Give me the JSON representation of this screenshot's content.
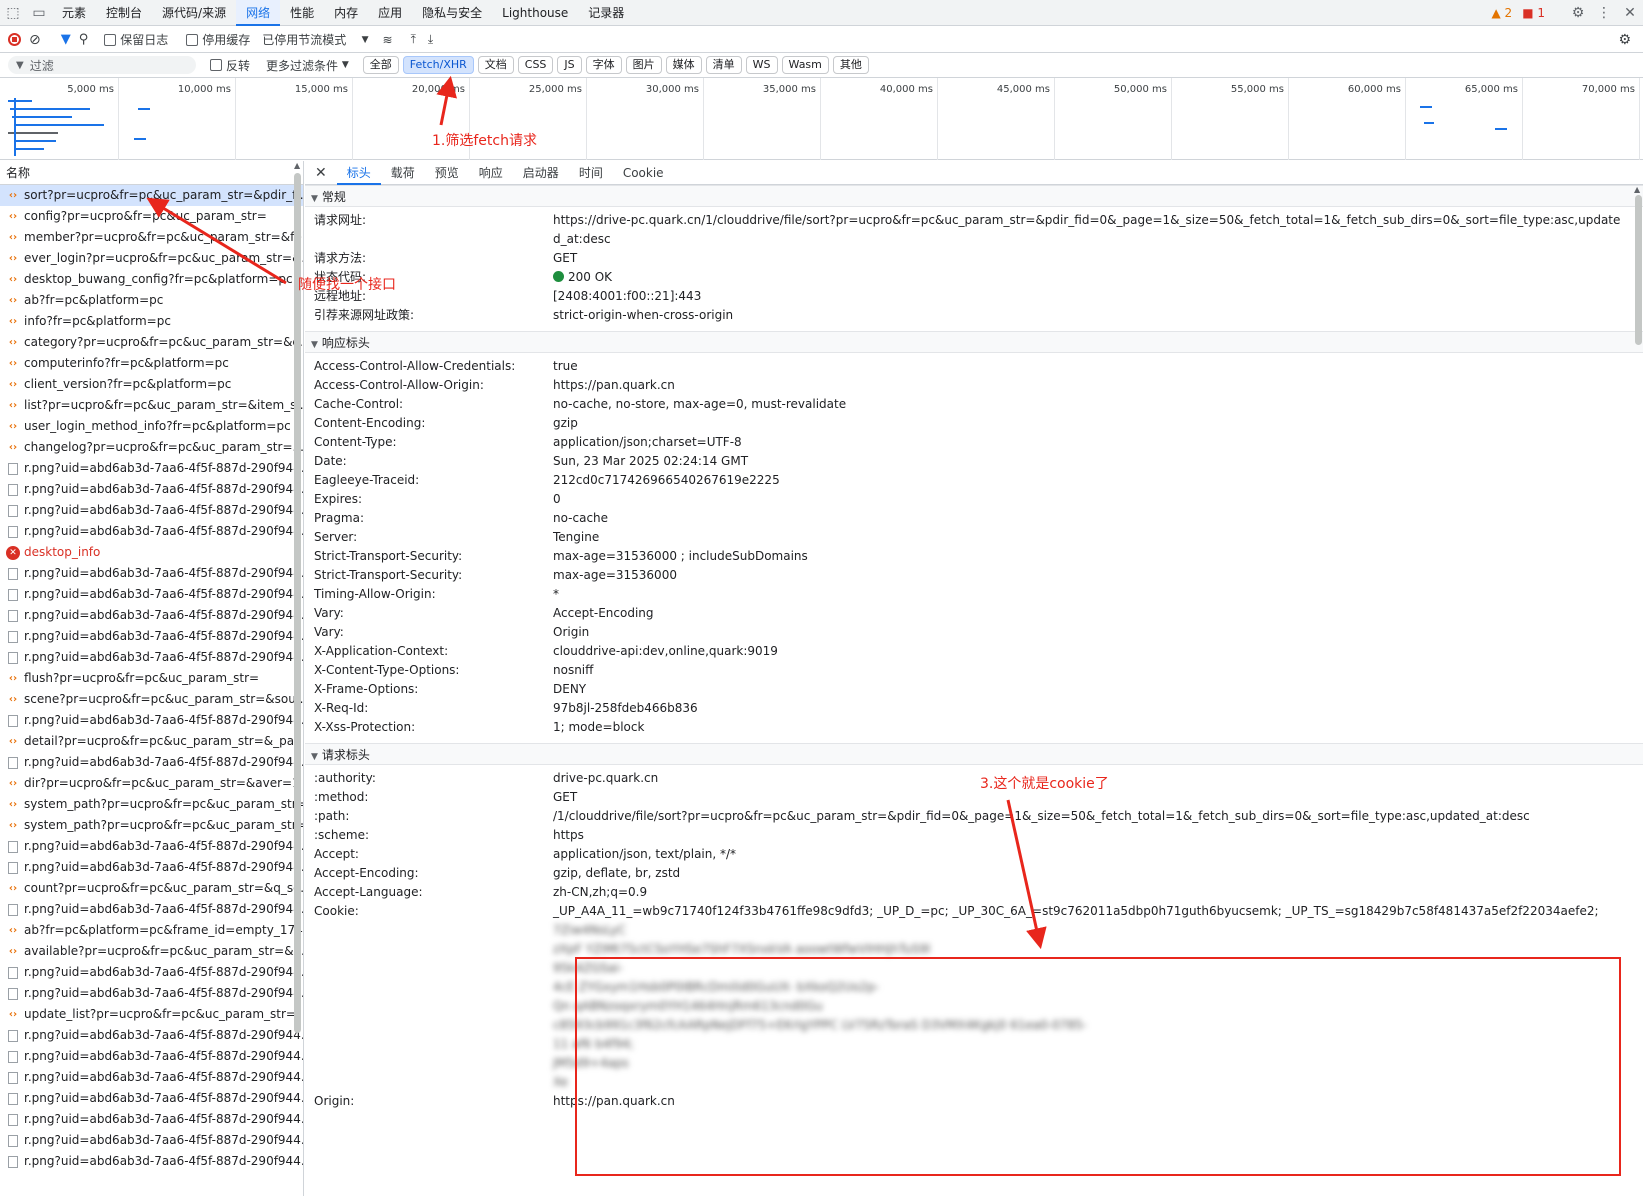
{
  "top_tabs": [
    "元素",
    "控制台",
    "源代码/来源",
    "网络",
    "性能",
    "内存",
    "应用",
    "隐私与安全",
    "Lighthouse",
    "记录器"
  ],
  "top_status": {
    "warnings": "2",
    "issues": "1"
  },
  "toolbar": {
    "preserve_log": "保留日志",
    "disable_cache": "停用缓存",
    "throttle": "已停用节流模式"
  },
  "filterbar": {
    "filter_placeholder": "过滤",
    "invert": "反转",
    "more_filters": "更多过滤条件",
    "chips": [
      "全部",
      "Fetch/XHR",
      "文档",
      "CSS",
      "JS",
      "字体",
      "图片",
      "媒体",
      "清单",
      "WS",
      "Wasm",
      "其他"
    ]
  },
  "timeline_ticks": [
    "5,000 ms",
    "10,000 ms",
    "15,000 ms",
    "20,000 ms",
    "25,000 ms",
    "30,000 ms",
    "35,000 ms",
    "40,000 ms",
    "45,000 ms",
    "50,000 ms",
    "55,000 ms",
    "60,000 ms",
    "65,000 ms",
    "70,000 ms"
  ],
  "list_header": "名称",
  "requests": [
    {
      "name": "sort?pr=ucpro&fr=pc&uc_param_str=&pdir_fi...",
      "type": "fetch"
    },
    {
      "name": "config?pr=ucpro&fr=pc&uc_param_str=",
      "type": "fetch"
    },
    {
      "name": "member?pr=ucpro&fr=pc&uc_param_str=&fe...",
      "type": "fetch"
    },
    {
      "name": "ever_login?pr=ucpro&fr=pc&uc_param_str=&...",
      "type": "fetch"
    },
    {
      "name": "desktop_buwang_config?fr=pc&platform=pc",
      "type": "fetch"
    },
    {
      "name": "ab?fr=pc&platform=pc",
      "type": "fetch"
    },
    {
      "name": "info?fr=pc&platform=pc",
      "type": "fetch"
    },
    {
      "name": "category?pr=ucpro&fr=pc&uc_param_str=&c...",
      "type": "fetch"
    },
    {
      "name": "computerinfo?fr=pc&platform=pc",
      "type": "fetch"
    },
    {
      "name": "client_version?fr=pc&platform=pc",
      "type": "fetch"
    },
    {
      "name": "list?pr=ucpro&fr=pc&uc_param_str=&item_si...",
      "type": "fetch"
    },
    {
      "name": "user_login_method_info?fr=pc&platform=pc",
      "type": "fetch"
    },
    {
      "name": "changelog?pr=ucpro&fr=pc&uc_param_str=...",
      "type": "fetch"
    },
    {
      "name": "r.png?uid=abd6ab3d-7aa6-4f5f-887d-290f944...",
      "type": "img"
    },
    {
      "name": "r.png?uid=abd6ab3d-7aa6-4f5f-887d-290f944...",
      "type": "img"
    },
    {
      "name": "r.png?uid=abd6ab3d-7aa6-4f5f-887d-290f944...",
      "type": "img"
    },
    {
      "name": "r.png?uid=abd6ab3d-7aa6-4f5f-887d-290f944...",
      "type": "img"
    },
    {
      "name": "desktop_info",
      "type": "err"
    },
    {
      "name": "r.png?uid=abd6ab3d-7aa6-4f5f-887d-290f944...",
      "type": "img"
    },
    {
      "name": "r.png?uid=abd6ab3d-7aa6-4f5f-887d-290f944...",
      "type": "img"
    },
    {
      "name": "r.png?uid=abd6ab3d-7aa6-4f5f-887d-290f944...",
      "type": "img"
    },
    {
      "name": "r.png?uid=abd6ab3d-7aa6-4f5f-887d-290f944...",
      "type": "img"
    },
    {
      "name": "r.png?uid=abd6ab3d-7aa6-4f5f-887d-290f944...",
      "type": "img"
    },
    {
      "name": "flush?pr=ucpro&fr=pc&uc_param_str=",
      "type": "fetch"
    },
    {
      "name": "scene?pr=ucpro&fr=pc&uc_param_str=&sour...",
      "type": "fetch"
    },
    {
      "name": "r.png?uid=abd6ab3d-7aa6-4f5f-887d-290f944...",
      "type": "img"
    },
    {
      "name": "detail?pr=ucpro&fr=pc&uc_param_str=&_pag...",
      "type": "fetch"
    },
    {
      "name": "r.png?uid=abd6ab3d-7aa6-4f5f-887d-290f944...",
      "type": "img"
    },
    {
      "name": "dir?pr=ucpro&fr=pc&uc_param_str=&aver=1",
      "type": "fetch"
    },
    {
      "name": "system_path?pr=ucpro&fr=pc&uc_param_str=",
      "type": "fetch"
    },
    {
      "name": "system_path?pr=ucpro&fr=pc&uc_param_str=",
      "type": "fetch"
    },
    {
      "name": "r.png?uid=abd6ab3d-7aa6-4f5f-887d-290f944...",
      "type": "img"
    },
    {
      "name": "r.png?uid=abd6ab3d-7aa6-4f5f-887d-290f944...",
      "type": "img"
    },
    {
      "name": "count?pr=ucpro&fr=pc&uc_param_str=&q_so...",
      "type": "fetch"
    },
    {
      "name": "r.png?uid=abd6ab3d-7aa6-4f5f-887d-290f944...",
      "type": "img"
    },
    {
      "name": "ab?fr=pc&platform=pc&frame_id=empty_174...",
      "type": "fetch"
    },
    {
      "name": "available?pr=ucpro&fr=pc&uc_param_str=&e...",
      "type": "fetch"
    },
    {
      "name": "r.png?uid=abd6ab3d-7aa6-4f5f-887d-290f944...",
      "type": "img"
    },
    {
      "name": "r.png?uid=abd6ab3d-7aa6-4f5f-887d-290f944...",
      "type": "img"
    },
    {
      "name": "update_list?pr=ucpro&fr=pc&uc_param_str=",
      "type": "fetch"
    },
    {
      "name": "r.png?uid=abd6ab3d-7aa6-4f5f-887d-290f944...",
      "type": "img"
    },
    {
      "name": "r.png?uid=abd6ab3d-7aa6-4f5f-887d-290f944...",
      "type": "img"
    },
    {
      "name": "r.png?uid=abd6ab3d-7aa6-4f5f-887d-290f944...",
      "type": "img"
    },
    {
      "name": "r.png?uid=abd6ab3d-7aa6-4f5f-887d-290f944...",
      "type": "img"
    },
    {
      "name": "r.png?uid=abd6ab3d-7aa6-4f5f-887d-290f944...",
      "type": "img"
    },
    {
      "name": "r.png?uid=abd6ab3d-7aa6-4f5f-887d-290f944...",
      "type": "img"
    },
    {
      "name": "r.png?uid=abd6ab3d-7aa6-4f5f-887d-290f944...",
      "type": "img"
    }
  ],
  "detail_tabs": [
    "标头",
    "载荷",
    "预览",
    "响应",
    "启动器",
    "时间",
    "Cookie"
  ],
  "general": {
    "title": "常规",
    "rows": [
      {
        "k": "请求网址:",
        "v": "https://drive-pc.quark.cn/1/clouddrive/file/sort?pr=ucpro&fr=pc&uc_param_str=&pdir_fid=0&_page=1&_size=50&_fetch_total=1&_fetch_sub_dirs=0&_sort=file_type:asc,updated_at:desc"
      },
      {
        "k": "请求方法:",
        "v": "GET"
      },
      {
        "k": "状态代码:",
        "v": "200 OK"
      },
      {
        "k": "远程地址:",
        "v": "[2408:4001:f00::21]:443"
      },
      {
        "k": "引荐来源网址政策:",
        "v": "strict-origin-when-cross-origin"
      }
    ]
  },
  "response_headers": {
    "title": "响应标头",
    "rows": [
      {
        "k": "Access-Control-Allow-Credentials:",
        "v": "true"
      },
      {
        "k": "Access-Control-Allow-Origin:",
        "v": "https://pan.quark.cn"
      },
      {
        "k": "Cache-Control:",
        "v": "no-cache, no-store, max-age=0, must-revalidate"
      },
      {
        "k": "Content-Encoding:",
        "v": "gzip"
      },
      {
        "k": "Content-Type:",
        "v": "application/json;charset=UTF-8"
      },
      {
        "k": "Date:",
        "v": "Sun, 23 Mar 2025 02:24:14 GMT"
      },
      {
        "k": "Eagleeye-Traceid:",
        "v": "212cd0c717426966540267619e2225"
      },
      {
        "k": "Expires:",
        "v": "0"
      },
      {
        "k": "Pragma:",
        "v": "no-cache"
      },
      {
        "k": "Server:",
        "v": "Tengine"
      },
      {
        "k": "Strict-Transport-Security:",
        "v": "max-age=31536000 ; includeSubDomains"
      },
      {
        "k": "Strict-Transport-Security:",
        "v": "max-age=31536000"
      },
      {
        "k": "Timing-Allow-Origin:",
        "v": "*"
      },
      {
        "k": "Vary:",
        "v": "Accept-Encoding"
      },
      {
        "k": "Vary:",
        "v": "Origin"
      },
      {
        "k": "X-Application-Context:",
        "v": "clouddrive-api:dev,online,quark:9019"
      },
      {
        "k": "X-Content-Type-Options:",
        "v": "nosniff"
      },
      {
        "k": "X-Frame-Options:",
        "v": "DENY"
      },
      {
        "k": "X-Req-Id:",
        "v": "97b8jl-258fdeb466b836"
      },
      {
        "k": "X-Xss-Protection:",
        "v": "1; mode=block"
      }
    ]
  },
  "request_headers": {
    "title": "请求标头",
    "rows": [
      {
        "k": ":authority:",
        "v": "drive-pc.quark.cn"
      },
      {
        "k": ":method:",
        "v": "GET"
      },
      {
        "k": ":path:",
        "v": "/1/clouddrive/file/sort?pr=ucpro&fr=pc&uc_param_str=&pdir_fid=0&_page=1&_size=50&_fetch_total=1&_fetch_sub_dirs=0&_sort=file_type:asc,updated_at:desc"
      },
      {
        "k": ":scheme:",
        "v": "https"
      },
      {
        "k": "Accept:",
        "v": "application/json, text/plain, */*"
      },
      {
        "k": "Accept-Encoding:",
        "v": "gzip, deflate, br, zstd"
      },
      {
        "k": "Accept-Language:",
        "v": "zh-CN,zh;q=0.9"
      }
    ],
    "cookie_key": "Cookie:",
    "cookie_lines": [
      "_UP_A4A_11_=wb9c71740f124f33b4761ffe98c9dfd3; _UP_D_=pc; _UP_30C_6A_=st9c762011a5dbp0h71guth6byucsemk; _UP_TS_=sg18429b7c58f481437a5ef2f22034aefe2;",
      "7Ziw4NsLyC",
      "zXpF YZIMt75ctCSoYHSe7ShF7XSnxkVA aoowtWfwVIHHjhTuS9l",
      "95k4ZGSai-",
      "4cE ZYGxym1Hsb0P0IBRcDmilid0GuUX- bXkoQ2Uo2p-",
      "Qn qABNzoqxrym0YH1464HnjRm613cnd0Gu",
      "c8593cb991c3f62cfcAARpNejDFf75+EKrlgYPPC LV75RzToraS D3VMX4Kgkj0 61ea0-0785-",
      "11 af6 b4f94;",
      "JM5d9+4aps",
      "Xe"
    ],
    "origin_key": "Origin:",
    "origin_value": "https://pan.quark.cn"
  },
  "annotations": {
    "a1": "1.筛选fetch请求",
    "a2": "随便找一个接口",
    "a3": "3.这个就是cookie了"
  },
  "colors": {
    "accent": "#1a73e8",
    "annotation": "#e8261c",
    "selected_row": "#d3e3fd"
  }
}
